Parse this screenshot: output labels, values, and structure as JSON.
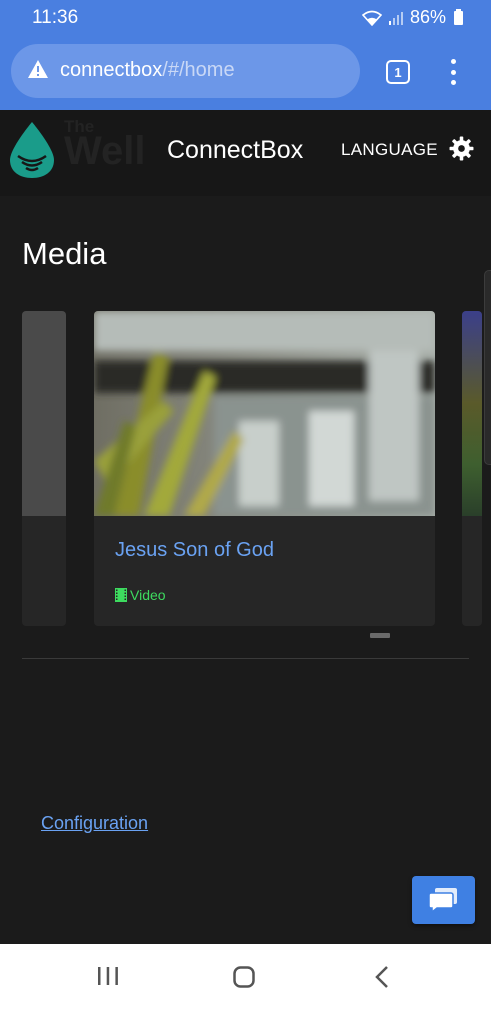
{
  "status_bar": {
    "time": "11:36",
    "battery": "86%"
  },
  "browser": {
    "url_host": "connectbox",
    "url_path": "/#/home",
    "tab_count": "1"
  },
  "navbar": {
    "logo_small": "The",
    "logo_big": "Well",
    "brand": "ConnectBox",
    "language_label": "LANGUAGE"
  },
  "main": {
    "section_title": "Media",
    "cards": [
      {
        "title": "Jesus Son of God",
        "type": "Video"
      }
    ]
  },
  "footer": {
    "config_link": "Configuration"
  },
  "colors": {
    "browser_bar": "#4a7fe0",
    "link": "#6aa2f2",
    "tag": "#3ddb5f",
    "chat_button": "#3f80e3",
    "logo": "#1a9c8a"
  }
}
